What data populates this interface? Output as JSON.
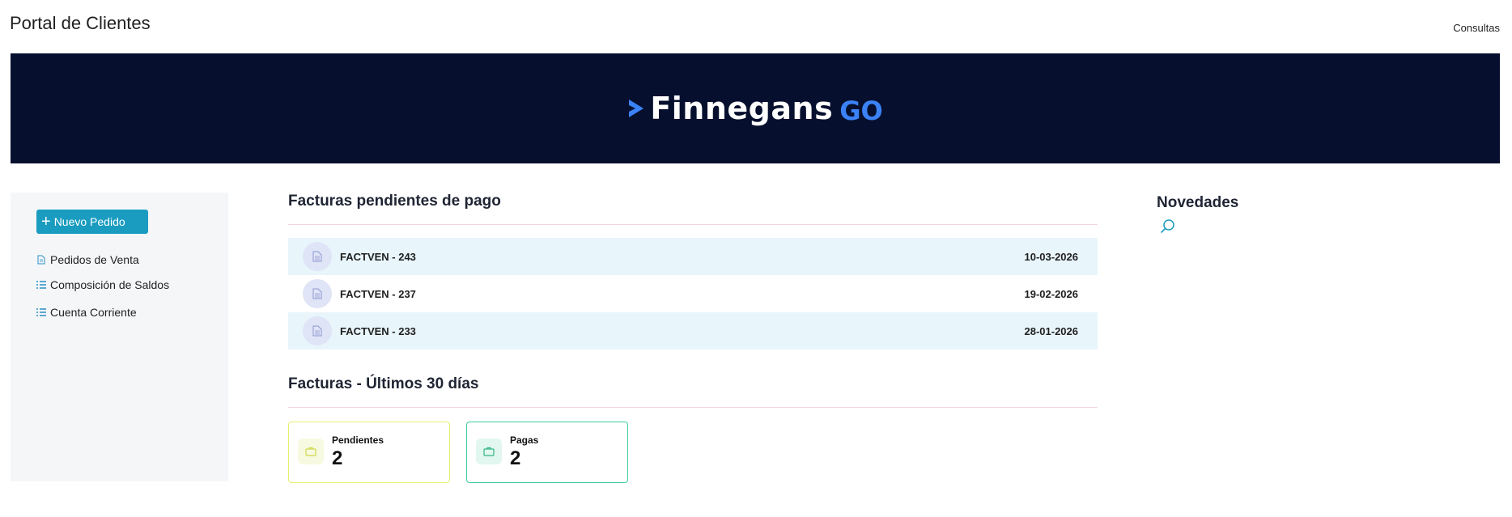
{
  "header": {
    "app_title": "Portal de Clientes",
    "consultas_link": "Consultas"
  },
  "banner": {
    "logo_text": "Finnegans",
    "logo_suffix": "GO",
    "background": "#06102e",
    "accent": "#3b82f6"
  },
  "sidebar": {
    "new_order_label": "Nuevo Pedido",
    "items": [
      {
        "label": "Pedidos de Venta",
        "icon": "document-icon"
      },
      {
        "label": "Composición de Saldos",
        "icon": "list-icon"
      },
      {
        "label": "Cuenta Corriente",
        "icon": "list-icon"
      }
    ]
  },
  "pending_invoices": {
    "title": "Facturas pendientes de pago",
    "rows": [
      {
        "id": "FACTVEN - 243",
        "date": "10-03-2026"
      },
      {
        "id": "FACTVEN - 237",
        "date": "19-02-2026"
      },
      {
        "id": "FACTVEN - 233",
        "date": "28-01-2026"
      }
    ]
  },
  "last_30_days": {
    "title": "Facturas - Últimos 30 días",
    "cards": [
      {
        "label": "Pendientes",
        "value": "2",
        "color": "#e5ef6b"
      },
      {
        "label": "Pagas",
        "value": "2",
        "color": "#3fcf9a"
      }
    ]
  },
  "news": {
    "title": "Novedades"
  }
}
